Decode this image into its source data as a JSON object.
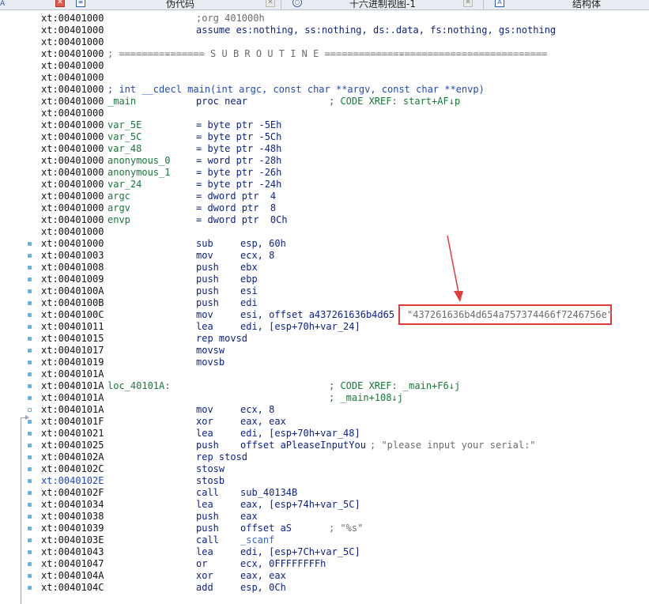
{
  "tabs": {
    "leftmost_letter": "A",
    "items": [
      {
        "label": "伪代码",
        "icon": "pseudocode-icon",
        "icon_glyph": "≡",
        "close_glyph": "✕"
      },
      {
        "label": "十六进制视图-1",
        "icon": "hex-view-icon",
        "icon_glyph": "○",
        "close_glyph": "✕"
      },
      {
        "label": "结构体",
        "icon": "structures-icon",
        "icon_glyph": "A",
        "close_glyph": "✕"
      }
    ]
  },
  "listing": {
    "org_line": ";org 401000h",
    "assume": "assume es:nothing, ss:nothing, ds:.data, fs:nothing, gs:nothing",
    "subroutine_header": "; =============== S U B R O U T I N E =======================================",
    "func_sig": "; int __cdecl main(int argc, const char **argv, const char **envp)",
    "main_label": "_main",
    "main_proc": "proc near",
    "main_xref": "; CODE XREF: start+AF↓p",
    "vars": [
      {
        "addr": "xt:00401000",
        "name": "var_5E",
        "def": "= byte ptr -5Eh"
      },
      {
        "addr": "xt:00401000",
        "name": "var_5C",
        "def": "= byte ptr -5Ch"
      },
      {
        "addr": "xt:00401000",
        "name": "var_48",
        "def": "= byte ptr -48h"
      },
      {
        "addr": "xt:00401000",
        "name": "anonymous_0",
        "def": "= word ptr -28h"
      },
      {
        "addr": "xt:00401000",
        "name": "anonymous_1",
        "def": "= byte ptr -26h"
      },
      {
        "addr": "xt:00401000",
        "name": "var_24",
        "def": "= byte ptr -24h"
      },
      {
        "addr": "xt:00401000",
        "name": "argc",
        "def": "= dword ptr  4"
      },
      {
        "addr": "xt:00401000",
        "name": "argv",
        "def": "= dword ptr  8"
      },
      {
        "addr": "xt:00401000",
        "name": "envp",
        "def": "= dword ptr  0Ch"
      }
    ],
    "loc_label": "loc_40101A:",
    "loc_xref1": "; CODE XREF: _main+F6↓j",
    "loc_xref2": "; _main+108↓j",
    "addrs": {
      "a0": "xt:00401000",
      "a1003": "xt:00401003",
      "a1008": "xt:00401008",
      "a1009": "xt:00401009",
      "a100A": "xt:0040100A",
      "a100B": "xt:0040100B",
      "a100C": "xt:0040100C",
      "a1011": "xt:00401011",
      "a1015": "xt:00401015",
      "a1017": "xt:00401017",
      "a1019": "xt:00401019",
      "a101A": "xt:0040101A",
      "a101F": "xt:0040101F",
      "a1021": "xt:00401021",
      "a1025": "xt:00401025",
      "a102A": "xt:0040102A",
      "a102C": "xt:0040102C",
      "a102E": "xt:0040102E",
      "a102F": "xt:0040102F",
      "a1034": "xt:00401034",
      "a1038": "xt:00401038",
      "a1039": "xt:00401039",
      "a103E": "xt:0040103E",
      "a1043": "xt:00401043",
      "a1047": "xt:00401047",
      "a104A": "xt:0040104A",
      "a104C": "xt:0040104C"
    },
    "ins": {
      "sub_m": "sub",
      "sub_o": "esp, 60h",
      "mov1_m": "mov",
      "mov1_o": "ecx, 8",
      "push1_m": "push",
      "push1_o": "ebx",
      "push2_m": "push",
      "push2_o": "ebp",
      "push3_m": "push",
      "push3_o": "esi",
      "push4_m": "push",
      "push4_o": "edi",
      "mov2_m": "mov",
      "mov2_o": "esi, offset a437261636b4d65",
      "lea1_m": "lea",
      "lea1_o": "edi, [esp+70h+var_24]",
      "repmovsd": "rep movsd",
      "movsw": "movsw",
      "movsb": "movsb",
      "mov3_m": "mov",
      "mov3_o": "ecx, 8",
      "xor1_m": "xor",
      "xor1_o": "eax, eax",
      "lea2_m": "lea",
      "lea2_o": "edi, [esp+70h+var_48]",
      "push5_m": "push",
      "push5_o": "offset aPleaseInputYou",
      "push5_c": "; \"please input your serial:\"",
      "repstosd": "rep stosd",
      "stosw": "stosw",
      "stosb": "stosb",
      "call1_m": "call",
      "call1_o": "sub_40134B",
      "lea3_m": "lea",
      "lea3_o": "eax, [esp+74h+var_5C]",
      "push6_m": "push",
      "push6_o": "eax",
      "push7_m": "push",
      "push7_o": "offset aS",
      "push7_c": "; \"%s\"",
      "call2_m": "call",
      "call2_o": "_scanf",
      "lea4_m": "lea",
      "lea4_o": "edi, [esp+7Ch+var_5C]",
      "or_m": "or",
      "or_o": "ecx, 0FFFFFFFFh",
      "xor2_m": "xor",
      "xor2_o": "eax, eax",
      "add_m": "add",
      "add_o": "esp, 0Ch"
    }
  },
  "annotation": {
    "text": "\"437261636b4d654a757374466f7246756e\"",
    "color": "#e03c3c"
  }
}
